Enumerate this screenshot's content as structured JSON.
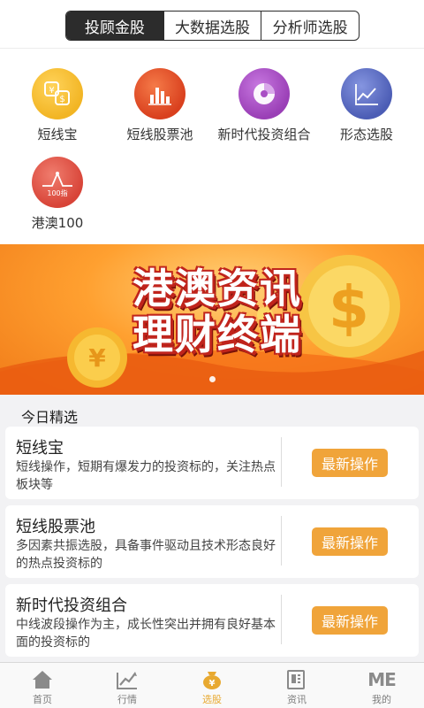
{
  "top_tabs": [
    "投顾金股",
    "大数据选股",
    "分析师选股"
  ],
  "features": [
    {
      "label": "短线宝",
      "color": "#f2b524"
    },
    {
      "label": "短线股票池",
      "color": "#e2512a"
    },
    {
      "label": "新时代投资组合",
      "color": "#a94fc4"
    },
    {
      "label": "形态选股",
      "color": "#5d6fc4"
    },
    {
      "label": "港澳100",
      "color": "#e45b4e",
      "icon_text": "100指"
    }
  ],
  "banner": {
    "title_line1": "港澳资讯",
    "title_line2": "理财终端"
  },
  "section_title": "今日精选",
  "cards": [
    {
      "title": "短线宝",
      "desc": "短线操作，短期有爆发力的投资标的，关注热点板块等",
      "button": "最新操作"
    },
    {
      "title": "短线股票池",
      "desc": "多因素共振选股，具备事件驱动且技术形态良好的热点投资标的",
      "button": "最新操作"
    },
    {
      "title": "新时代投资组合",
      "desc": "中线波段操作为主，成长性突出并拥有良好基本面的投资标的",
      "button": "最新操作"
    }
  ],
  "tabbar": [
    {
      "label": "首页",
      "icon": "home-icon"
    },
    {
      "label": "行情",
      "icon": "chart-icon"
    },
    {
      "label": "选股",
      "icon": "stock-pick-icon"
    },
    {
      "label": "资讯",
      "icon": "news-icon"
    },
    {
      "label": "我的",
      "icon": "me-icon",
      "icon_text": "ME"
    }
  ],
  "colors": {
    "accent": "#f0a43a",
    "active_tab": "#e8a930",
    "segment_dark": "#2c2c2c"
  }
}
